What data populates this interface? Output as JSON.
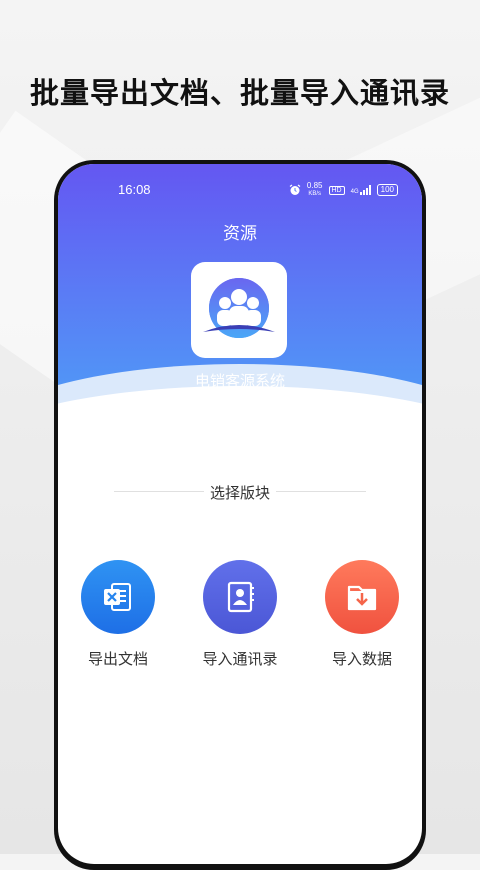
{
  "promo": {
    "headline": "批量导出文档、批量导入通讯录"
  },
  "status_bar": {
    "time": "16:08",
    "speed_value": "0.85",
    "speed_unit": "KB/s",
    "hd_label": "HD",
    "network_label": "4G",
    "battery_level": "100"
  },
  "app": {
    "screen_title": "资源",
    "name": "电销客源系统"
  },
  "modules": {
    "section_title": "选择版块",
    "items": [
      {
        "label": "导出文档",
        "icon": "excel-document-icon",
        "color": "#2584ee"
      },
      {
        "label": "导入通讯录",
        "icon": "contacts-book-icon",
        "color": "#5663e0"
      },
      {
        "label": "导入数据",
        "icon": "folder-download-icon",
        "color": "#f5654a"
      }
    ]
  },
  "colors": {
    "hero_top": "#6457f2",
    "hero_bottom": "#4aa7f7"
  }
}
